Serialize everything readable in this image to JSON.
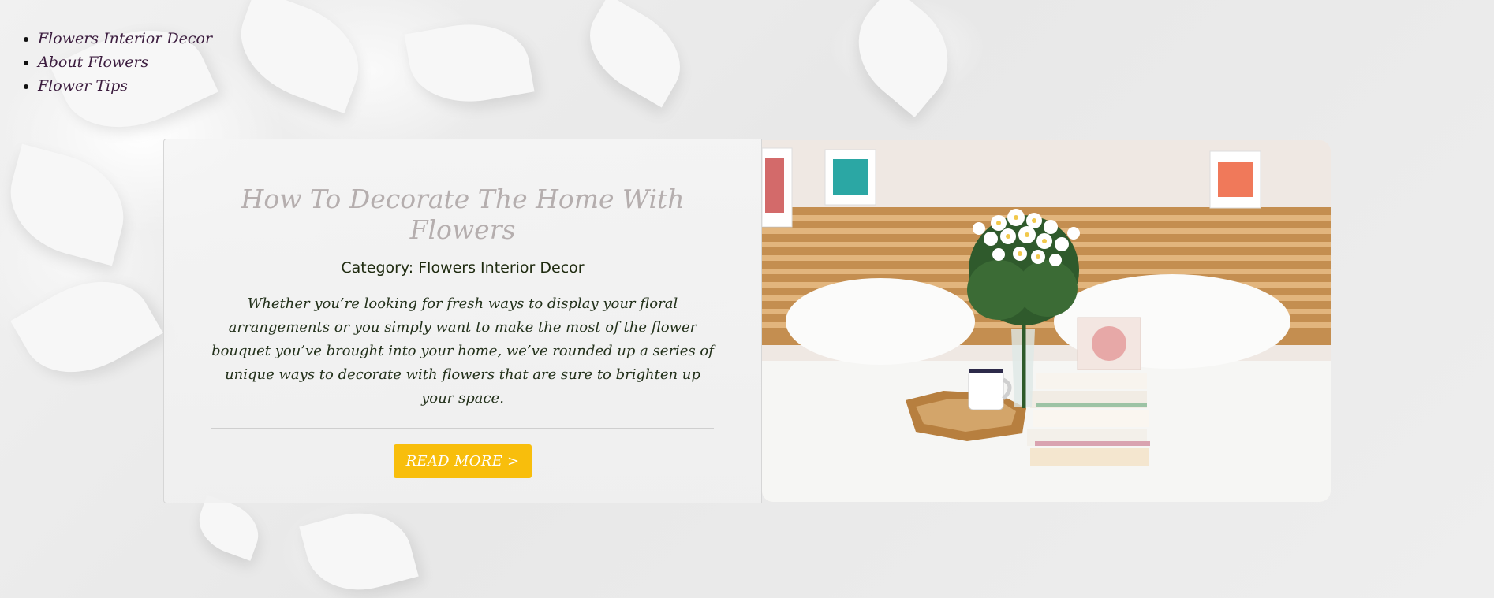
{
  "nav": {
    "items": [
      {
        "label": "Flowers Interior Decor"
      },
      {
        "label": "About Flowers"
      },
      {
        "label": "Flower Tips"
      }
    ]
  },
  "post": {
    "title": "How To Decorate The Home With Flowers",
    "category": "Category: Flowers Interior Decor",
    "excerpt": "Whether you’re looking for fresh ways to display your floral arrangements or you simply want to make the most of the flower bouquet you’ve brought into your home, we’ve rounded up a series of unique ways to decorate with flowers that are sure to brighten up your space.",
    "button_label": "READ MORE >"
  },
  "colors": {
    "button": "#f8be0c",
    "title": "#b5aeae",
    "nav_link": "#3c1d3f"
  }
}
